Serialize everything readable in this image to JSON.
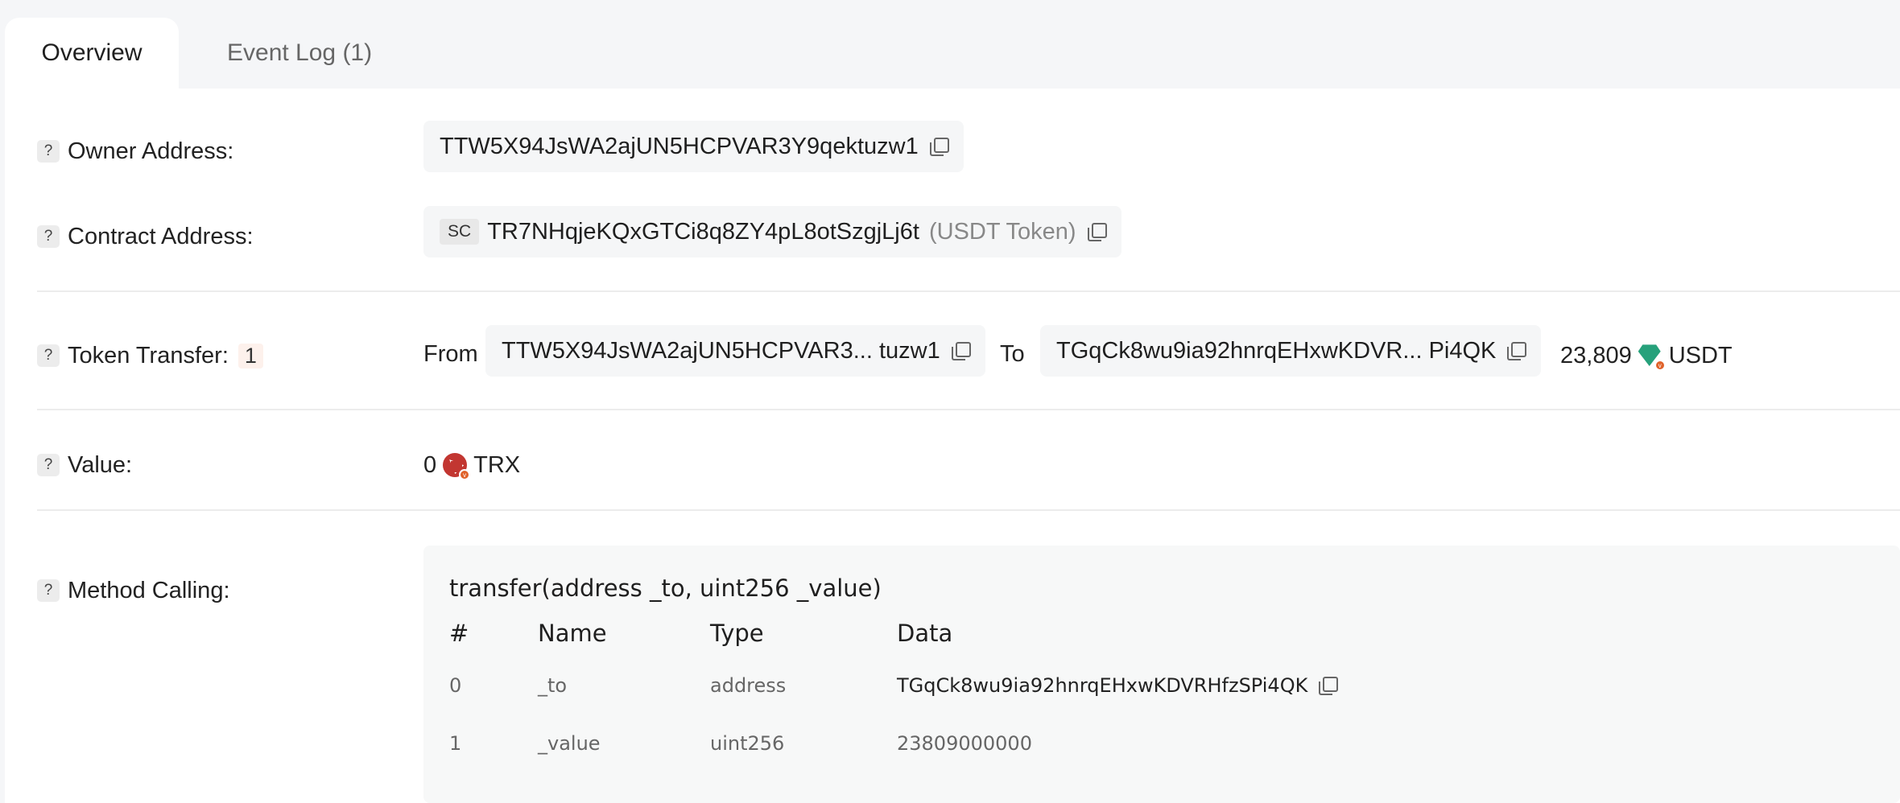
{
  "tabs": [
    {
      "label": "Overview"
    },
    {
      "label": "Event Log (1)"
    }
  ],
  "owner": {
    "label": "Owner Address:",
    "address": "TTW5X94JsWA2ajUN5HCPVAR3Y9qektuzw1"
  },
  "contract": {
    "label": "Contract Address:",
    "badge": "SC",
    "address": "TR7NHqjeKQxGTCi8q8ZY4pL8otSzgjLj6t",
    "token_name": "(USDT Token)"
  },
  "transfer": {
    "label": "Token Transfer:",
    "count": "1",
    "from_label": "From",
    "from_address": "TTW5X94JsWA2ajUN5HCPVAR3... tuzw1",
    "to_label": "To",
    "to_address": "TGqCk8wu9ia92hnrqEHxwKDVR... Pi4QK",
    "amount": "23,809",
    "token_icon": "usdt-icon",
    "symbol": "USDT"
  },
  "value": {
    "label": "Value:",
    "amount": "0",
    "token_icon": "trx-icon",
    "symbol": "TRX"
  },
  "method": {
    "label": "Method Calling:",
    "signature": "transfer(address _to, uint256 _value)",
    "columns": [
      "#",
      "Name",
      "Type",
      "Data"
    ],
    "rows": [
      {
        "index": "0",
        "name": "_to",
        "type": "address",
        "data": "TGqCk8wu9ia92hnrqEHxwKDVRHfzSPi4QK"
      },
      {
        "index": "1",
        "name": "_value",
        "type": "uint256",
        "data": "23809000000"
      }
    ]
  },
  "help_icon": "?",
  "colors": {
    "usdt": "#26a17b",
    "trx": "#c23631",
    "accent": "#e0622a"
  }
}
